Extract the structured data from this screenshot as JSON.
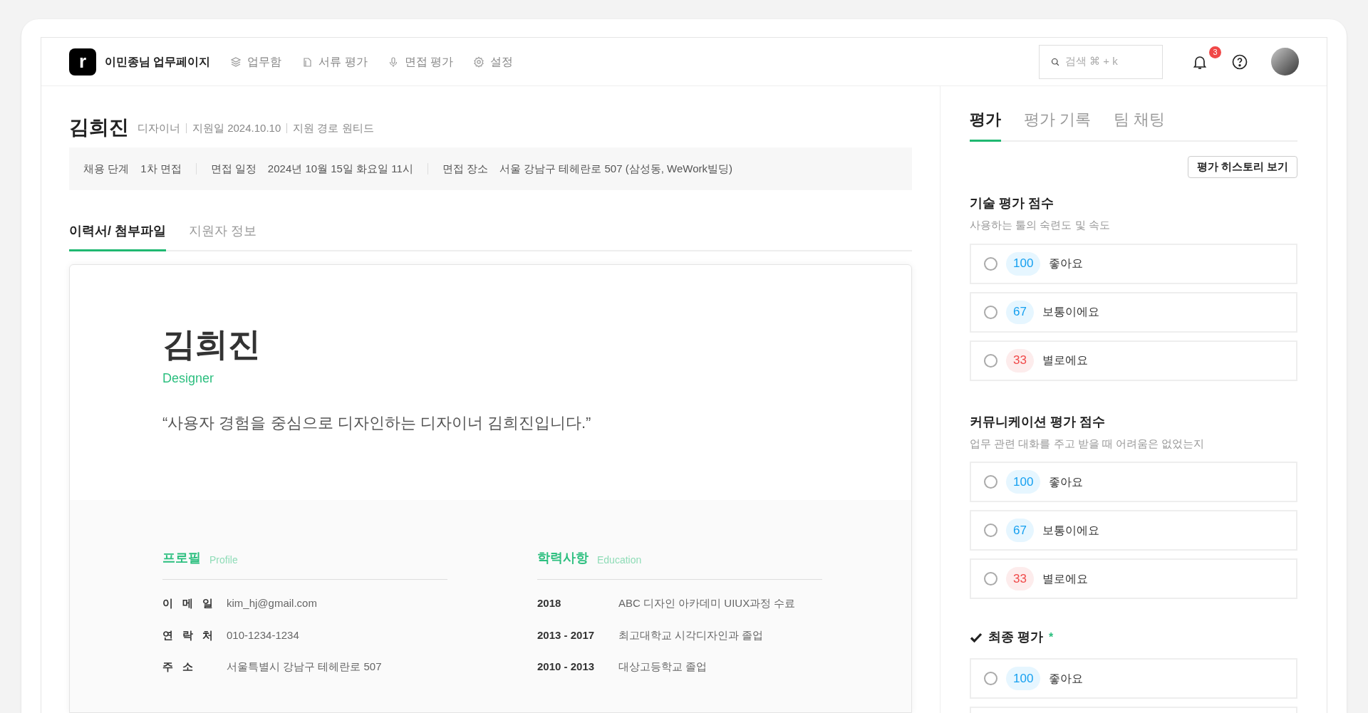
{
  "header": {
    "logo": "r",
    "workspace": "이민종님 업무페이지",
    "nav": [
      {
        "label": "업무함",
        "kind": "layers"
      },
      {
        "label": "서류 평가",
        "kind": "doc"
      },
      {
        "label": "면접 평가",
        "kind": "mic"
      },
      {
        "label": "설정",
        "kind": "gear"
      }
    ],
    "search": {
      "placeholder": "검색 ⌘ + k"
    },
    "notification_count": "3"
  },
  "candidate": {
    "name": "김희진",
    "meta": [
      "디자이너",
      "지원일 2024.10.10",
      "지원 경로 원티드"
    ],
    "info": [
      {
        "label": "채용 단계",
        "value": "1차 면접"
      },
      {
        "label": "면접 일정",
        "value": "2024년 10월 15일 화요일 11시"
      },
      {
        "label": "면접 장소",
        "value": "서울 강남구 테헤란로 507 (삼성동, WeWork빌딩)"
      }
    ]
  },
  "left_tabs": [
    {
      "label": "이력서/ 첨부파일",
      "selected": true
    },
    {
      "label": "지원자 정보",
      "selected": false
    }
  ],
  "resume": {
    "name": "김희진",
    "role": "Designer",
    "quote": "“사용자 경험을 중심으로 디자인하는 디자이너 김희진입니다.”",
    "profile": {
      "title": "프로필",
      "subtitle": "Profile",
      "rows": [
        {
          "label": "이 메 일",
          "value": "kim_hj@gmail.com"
        },
        {
          "label": "연 락 처",
          "value": "010-1234-1234"
        },
        {
          "label": "주 소",
          "value": "서울특별시 강남구 테헤란로 507"
        }
      ]
    },
    "education": {
      "title": "학력사항",
      "subtitle": "Education",
      "rows": [
        {
          "label": "2018",
          "value": "ABC 디자인 아카데미 UIUX과정 수료"
        },
        {
          "label": "2013 - 2017",
          "value": "최고대학교 시각디자인과 졸업"
        },
        {
          "label": "2010 - 2013",
          "value": "대상고등학교 졸업"
        }
      ]
    }
  },
  "right_tabs": [
    {
      "label": "평가",
      "selected": true
    },
    {
      "label": "평가 기록",
      "selected": false
    },
    {
      "label": "팀 채팅",
      "selected": false
    }
  ],
  "history_button": "평가 히스토리 보기",
  "sections": [
    {
      "title": "기술 평가 점수",
      "subtitle": "사용하는 툴의 숙련도 및 속도",
      "options": [
        {
          "score": "100",
          "label": "좋아요",
          "kind": "good",
          "selected": false
        },
        {
          "score": "67",
          "label": "보통이에요",
          "kind": "good",
          "selected": false
        },
        {
          "score": "33",
          "label": "별로에요",
          "kind": "bad",
          "selected": false
        }
      ]
    },
    {
      "title": "커뮤니케이션 평가 점수",
      "subtitle": "업무 관련 대화를 주고 받을 때 어려움은 없었는지",
      "options": [
        {
          "score": "100",
          "label": "좋아요",
          "kind": "good",
          "selected": false
        },
        {
          "score": "67",
          "label": "보통이에요",
          "kind": "good",
          "selected": false
        },
        {
          "score": "33",
          "label": "별로에요",
          "kind": "bad",
          "selected": false
        }
      ]
    },
    {
      "title": "최종 평가",
      "required": "*",
      "checked": true,
      "options": [
        {
          "score": "100",
          "label": "좋아요",
          "kind": "good",
          "selected": false
        }
      ]
    }
  ]
}
